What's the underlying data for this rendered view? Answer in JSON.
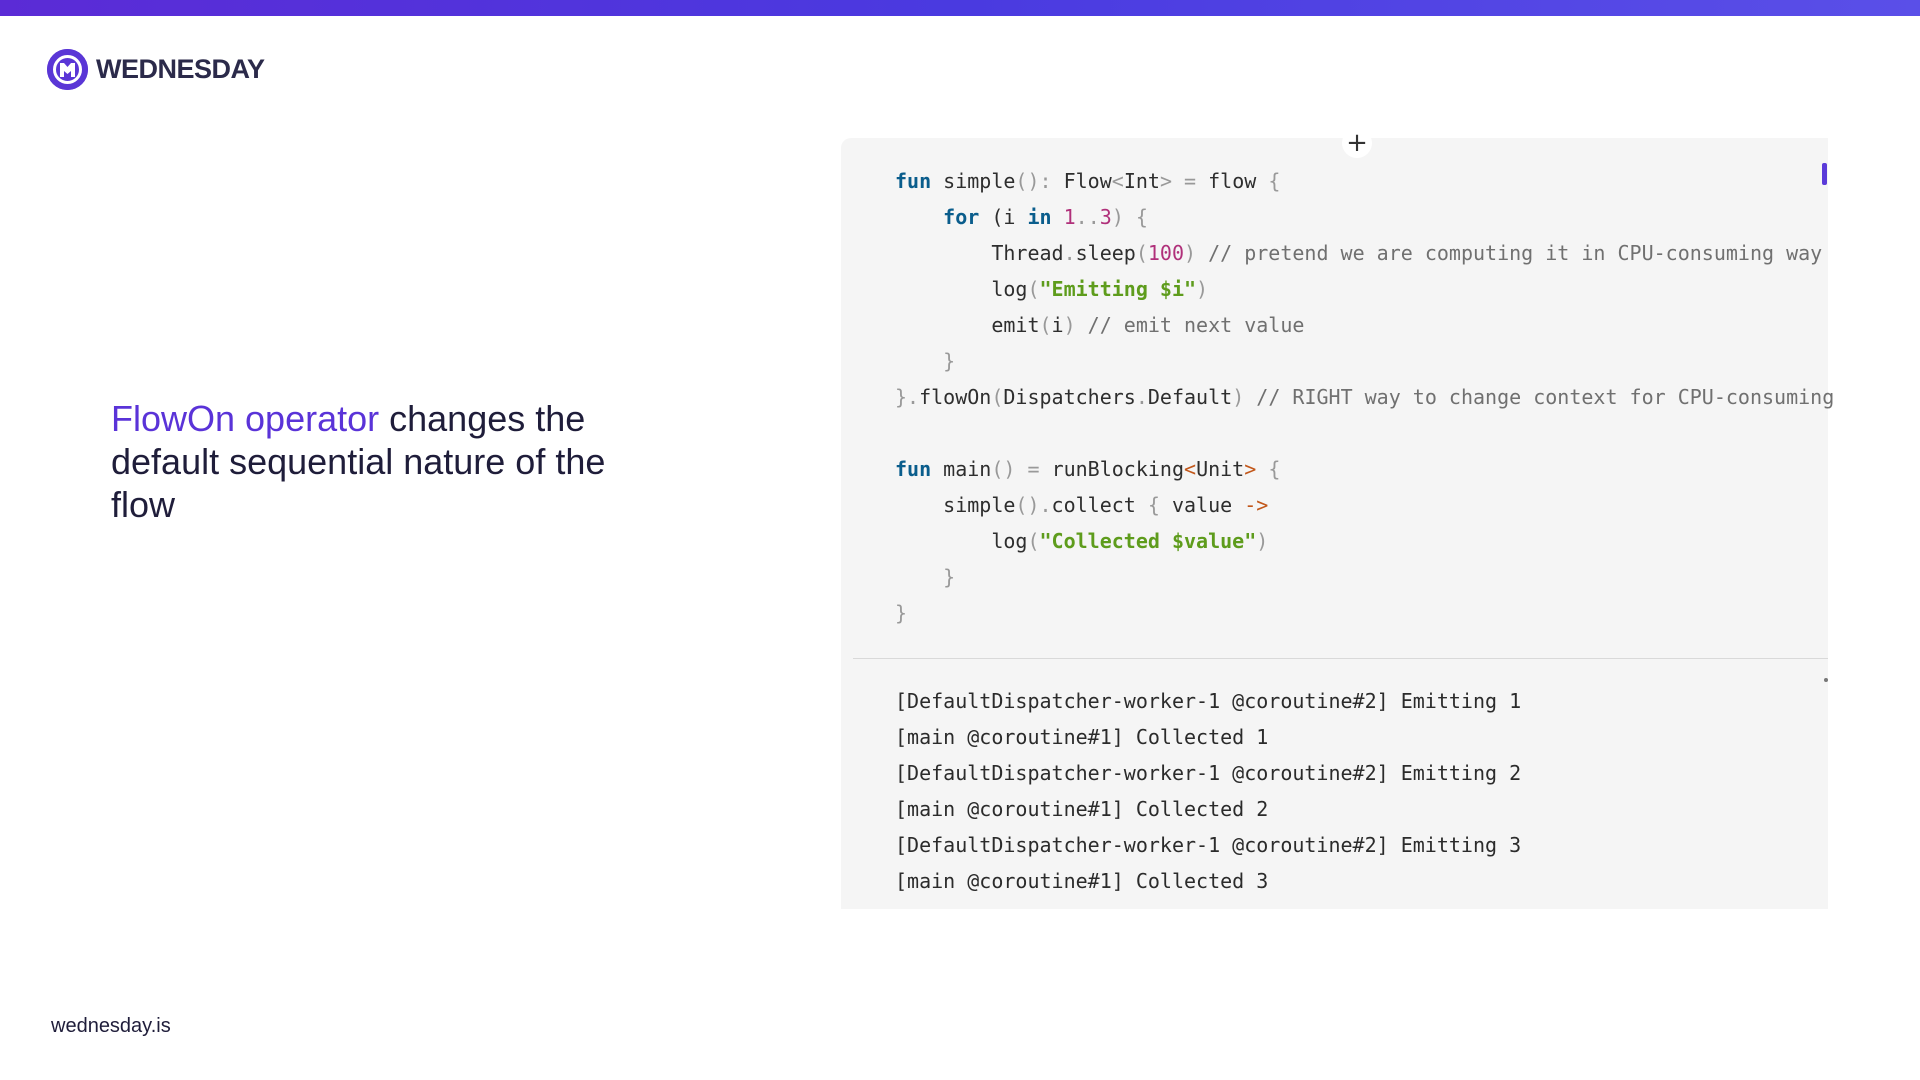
{
  "brand": {
    "name": "WEDNESDAY",
    "logo_icon": "wednesday-logo-icon",
    "accent_color": "#5a33d8",
    "url": "wednesday.is"
  },
  "headline": {
    "accent": "FlowOn operator",
    "rest": " changes the default sequential nature of the flow"
  },
  "code_panel": {
    "add_button_icon": "plus-icon",
    "code_lines": [
      [
        {
          "t": "fun",
          "c": "kw"
        },
        {
          "t": " simple"
        },
        {
          "t": "():",
          "c": "punc"
        },
        {
          "t": " Flow"
        },
        {
          "t": "<",
          "c": "punc"
        },
        {
          "t": "Int"
        },
        {
          "t": ">",
          "c": "punc"
        },
        {
          "t": " = ",
          "c": "punc"
        },
        {
          "t": "flow "
        },
        {
          "t": "{",
          "c": "punc"
        }
      ],
      [
        {
          "t": "    "
        },
        {
          "t": "for",
          "c": "kw"
        },
        {
          "t": " ("
        },
        {
          "t": "i "
        },
        {
          "t": "in",
          "c": "kw"
        },
        {
          "t": " "
        },
        {
          "t": "1",
          "c": "num"
        },
        {
          "t": "..",
          "c": "punc"
        },
        {
          "t": "3",
          "c": "num"
        },
        {
          "t": ") {",
          "c": "punc"
        }
      ],
      [
        {
          "t": "        Thread"
        },
        {
          "t": ".",
          "c": "punc"
        },
        {
          "t": "sleep"
        },
        {
          "t": "(",
          "c": "punc"
        },
        {
          "t": "100",
          "c": "num"
        },
        {
          "t": ")",
          "c": "punc"
        },
        {
          "t": " // pretend we are computing it in CPU-consuming way",
          "c": "cmt"
        }
      ],
      [
        {
          "t": "        log"
        },
        {
          "t": "(",
          "c": "punc"
        },
        {
          "t": "\"Emitting $i\"",
          "c": "str"
        },
        {
          "t": ")",
          "c": "punc"
        }
      ],
      [
        {
          "t": "        emit"
        },
        {
          "t": "(",
          "c": "punc"
        },
        {
          "t": "i"
        },
        {
          "t": ")",
          "c": "punc"
        },
        {
          "t": " // emit next value",
          "c": "cmt"
        }
      ],
      [
        {
          "t": "    }",
          "c": "punc"
        }
      ],
      [
        {
          "t": "}.",
          "c": "punc"
        },
        {
          "t": "flowOn"
        },
        {
          "t": "(",
          "c": "punc"
        },
        {
          "t": "Dispatchers"
        },
        {
          "t": ".",
          "c": "punc"
        },
        {
          "t": "Default"
        },
        {
          "t": ")",
          "c": "punc"
        },
        {
          "t": " // RIGHT way to change context for CPU-consuming",
          "c": "cmt"
        }
      ],
      [
        {
          "t": ""
        }
      ],
      [
        {
          "t": "fun",
          "c": "kw"
        },
        {
          "t": " main"
        },
        {
          "t": "()",
          "c": "punc"
        },
        {
          "t": " = ",
          "c": "punc"
        },
        {
          "t": "runBlocking"
        },
        {
          "t": "<",
          "c": "op"
        },
        {
          "t": "Unit"
        },
        {
          "t": ">",
          "c": "op"
        },
        {
          "t": " {",
          "c": "punc"
        }
      ],
      [
        {
          "t": "    simple"
        },
        {
          "t": "().",
          "c": "punc"
        },
        {
          "t": "collect "
        },
        {
          "t": "{",
          "c": "punc"
        },
        {
          "t": " value "
        },
        {
          "t": "->",
          "c": "op"
        }
      ],
      [
        {
          "t": "        log"
        },
        {
          "t": "(",
          "c": "punc"
        },
        {
          "t": "\"Collected $value\"",
          "c": "str"
        },
        {
          "t": ")",
          "c": "punc"
        }
      ],
      [
        {
          "t": "    }",
          "c": "punc"
        }
      ],
      [
        {
          "t": "}",
          "c": "punc"
        }
      ]
    ],
    "output_lines": [
      "[DefaultDispatcher-worker-1 @coroutine#2] Emitting 1",
      "[main @coroutine#1] Collected 1",
      "[DefaultDispatcher-worker-1 @coroutine#2] Emitting 2",
      "[main @coroutine#1] Collected 2",
      "[DefaultDispatcher-worker-1 @coroutine#2] Emitting 3",
      "[main @coroutine#1] Collected 3"
    ]
  }
}
